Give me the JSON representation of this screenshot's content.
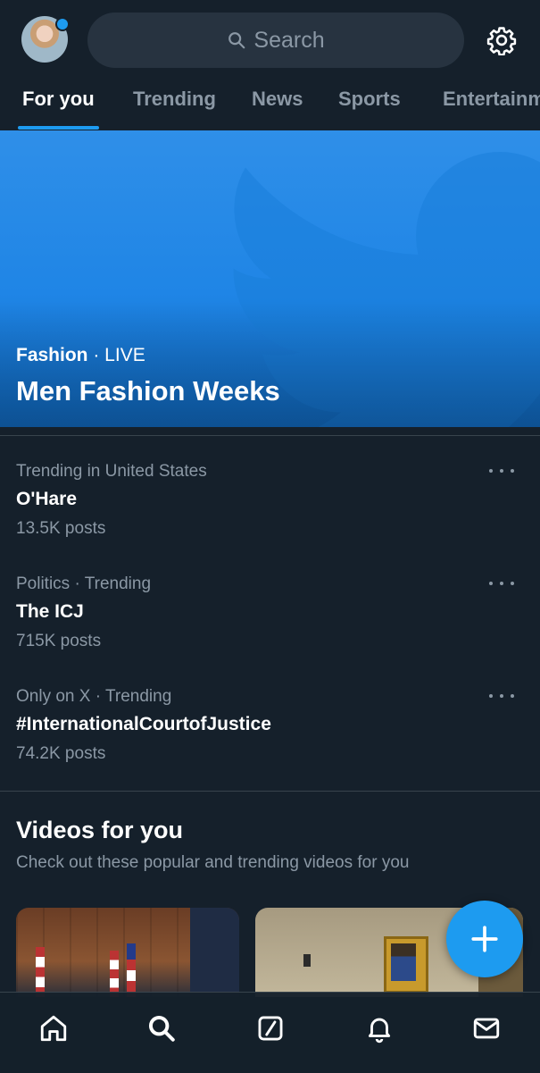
{
  "header": {
    "search": {
      "placeholder": "Search",
      "icon": "search-icon"
    },
    "settings_icon": "gear-icon",
    "avatar_icon": "avatar",
    "tabs": [
      {
        "label": "For you",
        "active": true
      },
      {
        "label": "Trending",
        "active": false
      },
      {
        "label": "News",
        "active": false
      },
      {
        "label": "Sports",
        "active": false
      },
      {
        "label": "Entertainm",
        "active": false
      }
    ]
  },
  "hero": {
    "category": "Fashion",
    "status": " · LIVE",
    "title": "Men Fashion Weeks"
  },
  "trends": [
    {
      "meta": "Trending in United States",
      "title": "O'Hare",
      "count": "13.5K posts"
    },
    {
      "meta": "Politics · Trending",
      "title": "The ICJ",
      "count": "715K posts"
    },
    {
      "meta": "Only on X · Trending",
      "title": "#InternationalCourtofJustice",
      "count": "74.2K posts"
    }
  ],
  "videos_section": {
    "title": "Videos for you",
    "subtitle": "Check out these popular and trending videos for you"
  },
  "colors": {
    "background": "#15202b",
    "accent": "#1d9bf0",
    "muted_text": "#8b98a5",
    "divider": "#38444d"
  },
  "bottom_nav": [
    "home-icon",
    "search-icon",
    "grok-icon",
    "bell-icon",
    "mail-icon"
  ],
  "fab_icon": "plus-icon"
}
